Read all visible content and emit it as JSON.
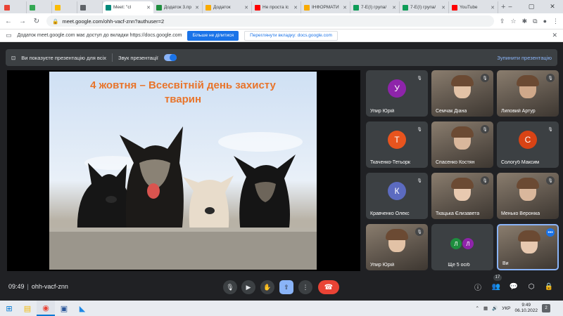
{
  "browser": {
    "tabs": [
      {
        "label": "",
        "color": "#ea4335"
      },
      {
        "label": "",
        "color": "#34a853"
      },
      {
        "label": "",
        "color": "#fbbc04"
      },
      {
        "label": "",
        "color": "#5f6368"
      },
      {
        "label": "Meet: \"cl",
        "color": "#00897b",
        "active": true
      },
      {
        "label": "Додаток 3.пр",
        "color": "#1e8e3e"
      },
      {
        "label": "Додаток",
        "color": "#f9ab00"
      },
      {
        "label": "Не проста іс",
        "color": "#ff0000"
      },
      {
        "label": "ІНФОРМАТИ",
        "color": "#f9ab00"
      },
      {
        "label": "7-Е(І) група/",
        "color": "#0f9d58"
      },
      {
        "label": "7-Е(І) група/",
        "color": "#0f9d58"
      },
      {
        "label": "YouTube",
        "color": "#ff0000"
      }
    ],
    "url": "meet.google.com/ohh-vacf-znn?authuser=2"
  },
  "infobar": {
    "message": "Додаток meet.google.com має доступ до вкладки https://docs.google.com",
    "stop_label": "Більше не ділитися",
    "switch_label": "Переглянути вкладку: docs.google.com"
  },
  "presentation_bar": {
    "presenting_label": "Ви показуєте презентацію для всіх",
    "audio_label": "Звук презентації",
    "stop_label": "Зупинити презентацію"
  },
  "slide": {
    "title_line1": "4 жовтня – Всесвітній день захисту",
    "title_line2": "тварин"
  },
  "participants": [
    {
      "name": "Упир Юрій",
      "initial": "У",
      "avatar_color": "#8e24aa",
      "camera": false
    },
    {
      "name": "Семчак Діана",
      "camera": true
    },
    {
      "name": "Липовий Артур",
      "camera": true
    },
    {
      "name": "Ткаченко-Тетьорк",
      "initial": "Т",
      "avatar_color": "#e8541e",
      "camera": false
    },
    {
      "name": "Спасенко Костян",
      "camera": true
    },
    {
      "name": "Сологуб Максим",
      "initial": "С",
      "avatar_color": "#d84315",
      "camera": false
    },
    {
      "name": "Кравченко Олекс",
      "initial": "К",
      "avatar_color": "#5c6bc0",
      "camera": false
    },
    {
      "name": "Ткацька Єлизавета",
      "camera": true
    },
    {
      "name": "Менько Вероніка",
      "camera": true
    },
    {
      "name": "Упир Юрій",
      "camera": true
    },
    {
      "name": "Ще 5 осіб",
      "initial_a": "Л",
      "initial_b": "Л",
      "color_a": "#1e8e3e",
      "color_b": "#8e24aa",
      "group": true
    },
    {
      "name": "Ви",
      "camera": true,
      "self": true
    }
  ],
  "meeting": {
    "time": "09:49",
    "code": "ohh-vacf-znn",
    "people_count": "17"
  },
  "taskbar": {
    "language": "УКР",
    "time": "9:49",
    "date": "06.10.2022",
    "notifications": "2"
  }
}
